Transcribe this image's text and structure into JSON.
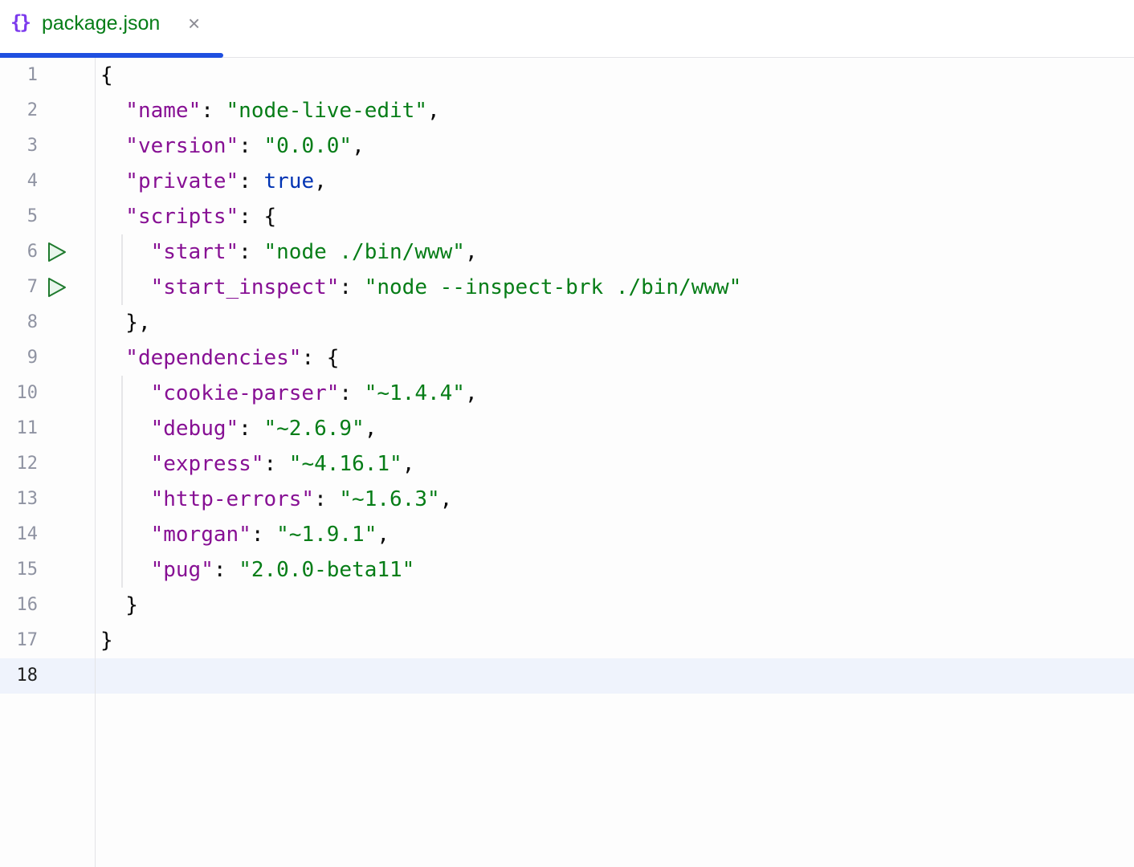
{
  "tab": {
    "icon": "json-braces-icon",
    "icon_glyph": "{}",
    "label": "package.json",
    "close_glyph": "×"
  },
  "colors": {
    "key": "#871094",
    "string": "#067d17",
    "boolean": "#0033b3",
    "accent": "#1f4fe0"
  },
  "current_line": 18,
  "run_lines": [
    6,
    7
  ],
  "lines": [
    {
      "n": "1",
      "indent": 0,
      "tokens": [
        [
          "p",
          "{"
        ]
      ]
    },
    {
      "n": "2",
      "indent": 1,
      "tokens": [
        [
          "k",
          "\"name\""
        ],
        [
          "p",
          ": "
        ],
        [
          "s",
          "\"node-live-edit\""
        ],
        [
          "p",
          ","
        ]
      ]
    },
    {
      "n": "3",
      "indent": 1,
      "tokens": [
        [
          "k",
          "\"version\""
        ],
        [
          "p",
          ": "
        ],
        [
          "s",
          "\"0.0.0\""
        ],
        [
          "p",
          ","
        ]
      ]
    },
    {
      "n": "4",
      "indent": 1,
      "tokens": [
        [
          "k",
          "\"private\""
        ],
        [
          "p",
          ": "
        ],
        [
          "b",
          "true"
        ],
        [
          "p",
          ","
        ]
      ]
    },
    {
      "n": "5",
      "indent": 1,
      "tokens": [
        [
          "k",
          "\"scripts\""
        ],
        [
          "p",
          ": {"
        ]
      ]
    },
    {
      "n": "6",
      "indent": 2,
      "tokens": [
        [
          "k",
          "\"start\""
        ],
        [
          "p",
          ": "
        ],
        [
          "s",
          "\"node ./bin/www\""
        ],
        [
          "p",
          ","
        ]
      ]
    },
    {
      "n": "7",
      "indent": 2,
      "tokens": [
        [
          "k",
          "\"start_inspect\""
        ],
        [
          "p",
          ": "
        ],
        [
          "s",
          "\"node --inspect-brk ./bin/www\""
        ]
      ]
    },
    {
      "n": "8",
      "indent": 1,
      "tokens": [
        [
          "p",
          "},"
        ]
      ]
    },
    {
      "n": "9",
      "indent": 1,
      "tokens": [
        [
          "k",
          "\"dependencies\""
        ],
        [
          "p",
          ": {"
        ]
      ]
    },
    {
      "n": "10",
      "indent": 2,
      "tokens": [
        [
          "k",
          "\"cookie-parser\""
        ],
        [
          "p",
          ": "
        ],
        [
          "s",
          "\"~1.4.4\""
        ],
        [
          "p",
          ","
        ]
      ]
    },
    {
      "n": "11",
      "indent": 2,
      "tokens": [
        [
          "k",
          "\"debug\""
        ],
        [
          "p",
          ": "
        ],
        [
          "s",
          "\"~2.6.9\""
        ],
        [
          "p",
          ","
        ]
      ]
    },
    {
      "n": "12",
      "indent": 2,
      "tokens": [
        [
          "k",
          "\"express\""
        ],
        [
          "p",
          ": "
        ],
        [
          "s",
          "\"~4.16.1\""
        ],
        [
          "p",
          ","
        ]
      ]
    },
    {
      "n": "13",
      "indent": 2,
      "tokens": [
        [
          "k",
          "\"http-errors\""
        ],
        [
          "p",
          ": "
        ],
        [
          "s",
          "\"~1.6.3\""
        ],
        [
          "p",
          ","
        ]
      ]
    },
    {
      "n": "14",
      "indent": 2,
      "tokens": [
        [
          "k",
          "\"morgan\""
        ],
        [
          "p",
          ": "
        ],
        [
          "s",
          "\"~1.9.1\""
        ],
        [
          "p",
          ","
        ]
      ]
    },
    {
      "n": "15",
      "indent": 2,
      "tokens": [
        [
          "k",
          "\"pug\""
        ],
        [
          "p",
          ": "
        ],
        [
          "s",
          "\"2.0.0-beta11\""
        ]
      ]
    },
    {
      "n": "16",
      "indent": 1,
      "tokens": [
        [
          "p",
          "}"
        ]
      ]
    },
    {
      "n": "17",
      "indent": 0,
      "tokens": [
        [
          "p",
          "}"
        ]
      ]
    },
    {
      "n": "18",
      "indent": 0,
      "tokens": []
    }
  ]
}
